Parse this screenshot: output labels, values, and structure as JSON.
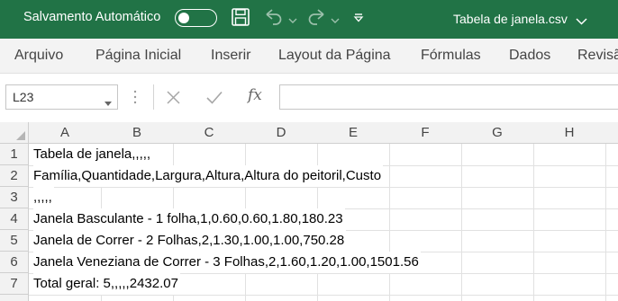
{
  "titlebar": {
    "autosave_label": "Salvamento Automático",
    "filename": "Tabela de janela.csv",
    "icons": [
      "save-icon",
      "undo-icon",
      "redo-icon",
      "customize-qat-icon",
      "chevron-down-icon"
    ]
  },
  "ribbon": {
    "tabs": [
      "Arquivo",
      "Página Inicial",
      "Inserir",
      "Layout da Página",
      "Fórmulas",
      "Dados",
      "Revisão"
    ]
  },
  "formula_bar": {
    "name_box": "L23",
    "fx_label": "fx",
    "formula": ""
  },
  "sheet": {
    "columns": [
      "A",
      "B",
      "C",
      "D",
      "E",
      "F",
      "G",
      "H"
    ],
    "rows": [
      "1",
      "2",
      "3",
      "4",
      "5",
      "6",
      "7"
    ],
    "cells": [
      "Tabela de janela,,,,,",
      "Família,Quantidade,Largura,Altura,Altura do peitoril,Custo",
      ",,,,,",
      "Janela Basculante - 1 folha,1,0.60,0.60,1.80,180.23",
      "Janela de Correr - 2 Folhas,2,1.30,1.00,1.00,750.28",
      "Janela Veneziana de Correr - 3 Folhas,2,1.60,1.20,1.00,1501.56",
      "Total geral: 5,,,,,2432.07"
    ]
  },
  "colors": {
    "accent": "#217346",
    "ribbon_bg": "#f3f3f3",
    "header_bg": "#f2f2f2",
    "gridline": "#e1e1e1"
  }
}
